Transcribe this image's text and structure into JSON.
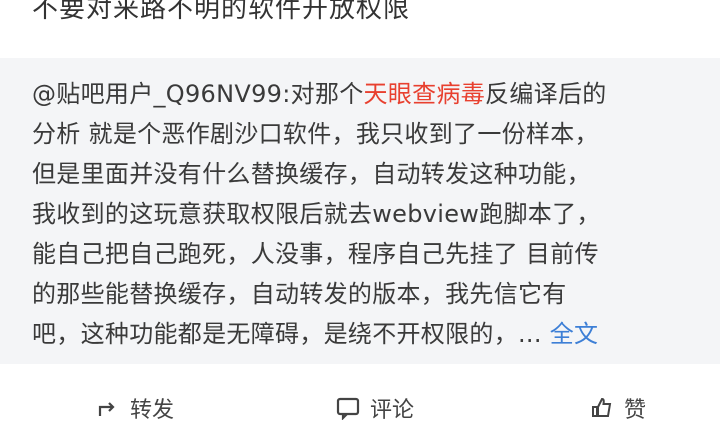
{
  "header": {
    "title": "不要对来路不明的软件开放权限"
  },
  "quote": {
    "author": "@贴吧用户_Q96NV99:",
    "lines": [
      {
        "before": "对那个",
        "highlight": "天眼查病毒",
        "after": "反编译后的"
      },
      "分析 就是个恶作剧沙口软件，我只收到了一份样本，",
      "但是里面并没有什么替换缓存，自动转发这种功能，",
      "我收到的这玩意获取权限后就去webview跑脚本了，",
      "能自己把自己跑死，人没事，程序自己先挂了 目前传",
      "的那些能替换缓存，自动转发的版本，我先信它有",
      "吧，这种功能都是无障碍，是绕不开权限的，..."
    ],
    "more_label": "全文"
  },
  "actions": {
    "share_label": "转发",
    "comment_label": "评论",
    "like_label": "赞"
  }
}
